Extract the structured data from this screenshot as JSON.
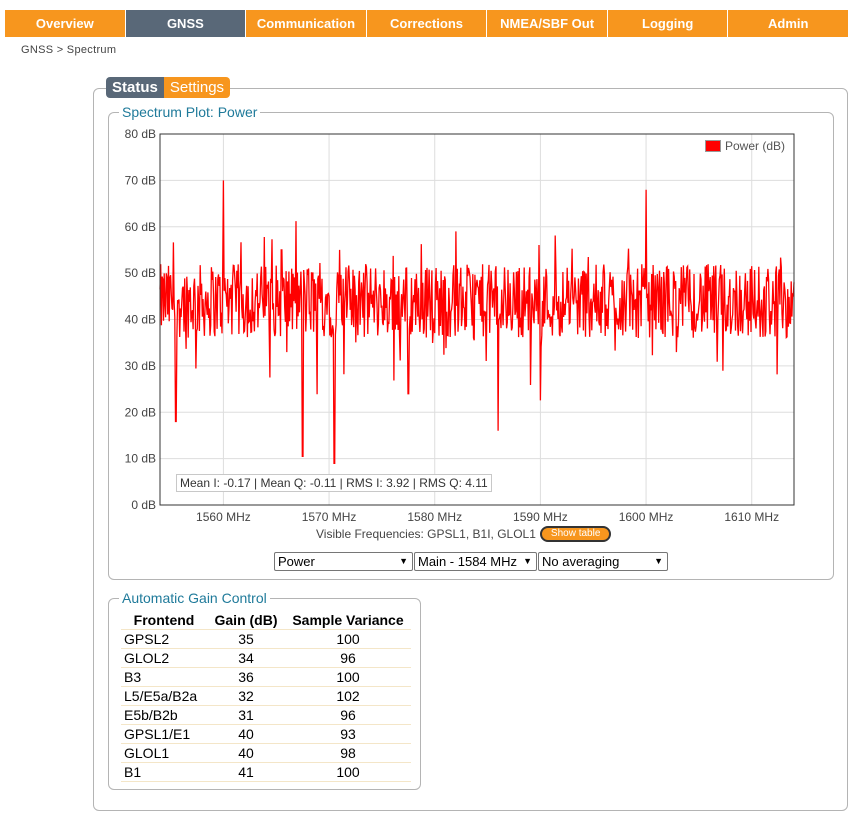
{
  "nav": {
    "tabs": [
      {
        "label": "Overview",
        "active": false
      },
      {
        "label": "GNSS",
        "active": true
      },
      {
        "label": "Communication",
        "active": false
      },
      {
        "label": "Corrections",
        "active": false
      },
      {
        "label": "NMEA/SBF Out",
        "active": false
      },
      {
        "label": "Logging",
        "active": false
      },
      {
        "label": "Admin",
        "active": false
      }
    ]
  },
  "breadcrumb": "GNSS > Spectrum",
  "subtabs": {
    "status": "Status",
    "settings": "Settings"
  },
  "spectrum": {
    "legend_title": "Spectrum Plot: Power",
    "stats": "Mean I: -0.17 | Mean Q: -0.11 | RMS I: 3.92 | RMS Q: 4.11",
    "visible_frequencies": "Visible Frequencies: GPSL1, B1I, GLOL1",
    "show_table_label": "Show table",
    "selects": {
      "mode": "Power",
      "band": "Main - 1584 MHz",
      "averaging": "No averaging"
    }
  },
  "chart_data": {
    "type": "line",
    "series": [
      {
        "name": "Power (dB)",
        "color": "#ff0000"
      }
    ],
    "xlim": [
      1554,
      1614
    ],
    "ylim": [
      0,
      80
    ],
    "x_ticks": [
      1560,
      1570,
      1580,
      1590,
      1600,
      1610
    ],
    "x_tick_labels": [
      "1560 MHz",
      "1570 MHz",
      "1580 MHz",
      "1590 MHz",
      "1600 MHz",
      "1610 MHz"
    ],
    "y_ticks": [
      0,
      10,
      20,
      30,
      40,
      50,
      60,
      70,
      80
    ],
    "y_tick_labels": [
      "0 dB",
      "10 dB",
      "20 dB",
      "30 dB",
      "40 dB",
      "50 dB",
      "60 dB",
      "70 dB",
      "80 dB"
    ],
    "noise_level_db": 44,
    "peaks": [
      {
        "x": 1560,
        "y": 70
      },
      {
        "x": 1565.5,
        "y": 55
      },
      {
        "x": 1571,
        "y": 55
      },
      {
        "x": 1582,
        "y": 59
      },
      {
        "x": 1600,
        "y": 68
      }
    ],
    "dips": [
      {
        "x": 1555.5,
        "y": 18
      },
      {
        "x": 1567.5,
        "y": 10.5
      },
      {
        "x": 1570.5,
        "y": 9
      },
      {
        "x": 1577.5,
        "y": 24
      },
      {
        "x": 1586,
        "y": 16
      }
    ],
    "grid": true,
    "legend_position": "top-right"
  },
  "agc": {
    "legend_title": "Automatic Gain Control",
    "headers": [
      "Frontend",
      "Gain (dB)",
      "Sample Variance"
    ],
    "rows": [
      [
        "GPSL2",
        "35",
        "100"
      ],
      [
        "GLOL2",
        "34",
        "96"
      ],
      [
        "B3",
        "36",
        "100"
      ],
      [
        "L5/E5a/B2a",
        "32",
        "102"
      ],
      [
        "E5b/B2b",
        "31",
        "96"
      ],
      [
        "GPSL1/E1",
        "40",
        "93"
      ],
      [
        "GLOL1",
        "40",
        "98"
      ],
      [
        "B1",
        "41",
        "100"
      ]
    ]
  }
}
